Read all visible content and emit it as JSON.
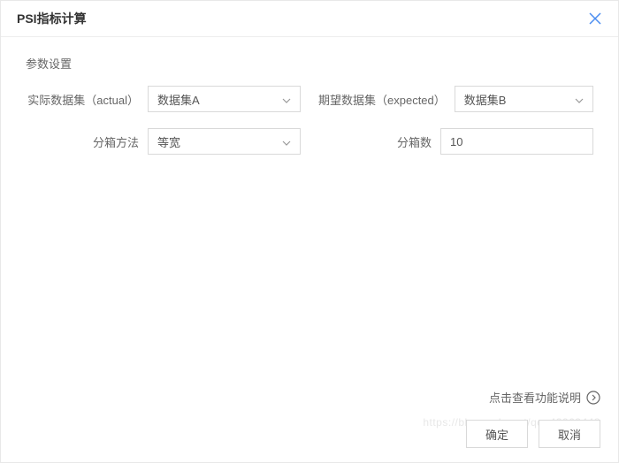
{
  "dialog": {
    "title": "PSI指标计算",
    "section_title": "参数设置",
    "fields": {
      "actual_label": "实际数据集（actual）",
      "actual_value": "数据集A",
      "expected_label": "期望数据集（expected）",
      "expected_value": "数据集B",
      "bin_method_label": "分箱方法",
      "bin_method_value": "等宽",
      "bin_count_label": "分箱数",
      "bin_count_value": "10"
    },
    "help_link": "点击查看功能说明",
    "confirm_label": "确定",
    "cancel_label": "取消"
  },
  "watermark": "https://blog.csdn.net/qq_42963448"
}
